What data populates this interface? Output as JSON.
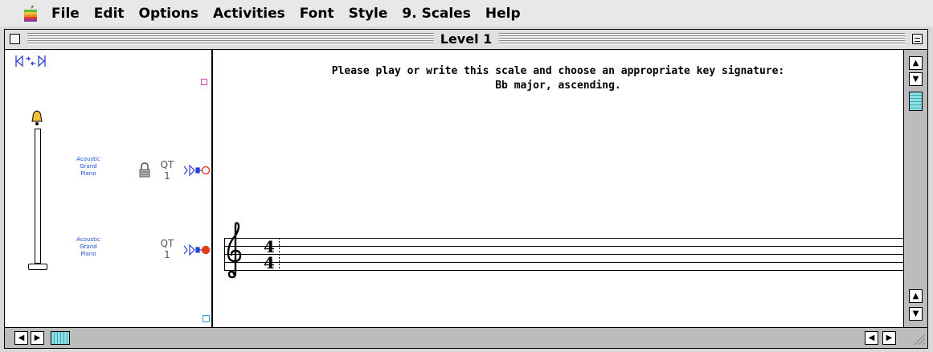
{
  "menubar": {
    "items": [
      "File",
      "Edit",
      "Options",
      "Activities",
      "Font",
      "Style",
      "9. Scales",
      "Help"
    ]
  },
  "window": {
    "title": "Level 1"
  },
  "score": {
    "instruction_line1": "Please play or write this scale and choose an appropriate key signature:",
    "instruction_line2": "Bb major, ascending.",
    "clef": "treble",
    "time_signature": "4/4"
  },
  "tracks": [
    {
      "instrument_lines": [
        "Acoustic",
        "Grand",
        "Piano"
      ],
      "qt_label": "QT",
      "qt_value": "1",
      "locked": true,
      "port_state": "off"
    },
    {
      "instrument_lines": [
        "Acoustic",
        "Grand",
        "Piano"
      ],
      "qt_label": "QT",
      "qt_value": "1",
      "locked": false,
      "port_state": "on"
    }
  ],
  "colors": {
    "instrument_text": "#1a4fd6",
    "port_off": "#e53c1c",
    "port_on": "#e53c1c",
    "marker_magenta": "#d43db8",
    "marker_cyan": "#2aa0c8"
  }
}
